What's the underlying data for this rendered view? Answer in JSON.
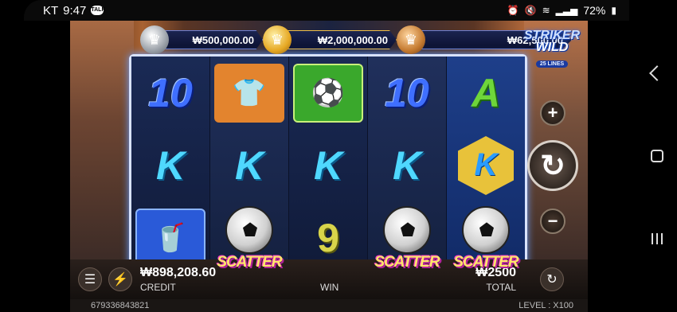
{
  "status_bar": {
    "carrier": "KT",
    "time": "9:47",
    "chat_badge": "TALK",
    "battery": "72%"
  },
  "jackpots": {
    "silver": "₩500,000.00",
    "gold": "₩2,000,000.00",
    "bronze": "₩62,500.00"
  },
  "logo": {
    "line1": "STRIKER",
    "line2": "WILD",
    "line3": "25 LINES"
  },
  "reels": [
    [
      "10",
      "K",
      "drinks"
    ],
    [
      "jersey",
      "K",
      "SCATTER"
    ],
    [
      "goal",
      "K",
      "9"
    ],
    [
      "10",
      "K",
      "SCATTER"
    ],
    [
      "A",
      "K-hex",
      "SCATTER"
    ]
  ],
  "controls": {
    "plus": "+",
    "minus": "−",
    "spin": "↻"
  },
  "bottom": {
    "credit_value": "₩898,208.60",
    "credit_label": "CREDIT",
    "win_label": "WIN",
    "total_value": "₩2500",
    "total_label": "TOTAL"
  },
  "footer": {
    "session_id": "679336843821",
    "level_text": "LEVEL : X100"
  }
}
